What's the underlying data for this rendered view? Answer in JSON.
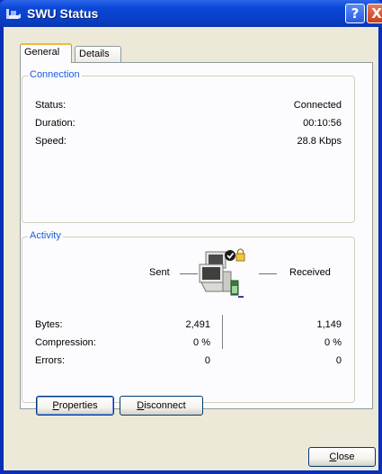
{
  "window": {
    "title": "SWU Status",
    "help_glyph": "?",
    "close_glyph": "X"
  },
  "tabs": [
    {
      "label": "General",
      "active": true
    },
    {
      "label": "Details",
      "active": false
    }
  ],
  "connection": {
    "legend": "Connection",
    "rows": [
      {
        "label": "Status:",
        "value": "Connected"
      },
      {
        "label": "Duration:",
        "value": "00:10:56"
      },
      {
        "label": "Speed:",
        "value": "28.8 Kbps"
      }
    ]
  },
  "activity": {
    "legend": "Activity",
    "sent_label": "Sent",
    "received_label": "Received",
    "rows": [
      {
        "label": "Bytes:",
        "sent": "2,491",
        "received": "1,149"
      },
      {
        "label": "Compression:",
        "sent": "0 %",
        "received": "0 %"
      },
      {
        "label": "Errors:",
        "sent": "0",
        "received": "0"
      }
    ]
  },
  "buttons": {
    "properties": {
      "pre": "",
      "accel": "P",
      "post": "roperties"
    },
    "disconnect": {
      "pre": "",
      "accel": "D",
      "post": "isconnect"
    },
    "close": {
      "pre": "",
      "accel": "C",
      "post": "lose"
    }
  },
  "colors": {
    "titlebar": "#0a47d8",
    "legend_text": "#1d5be0",
    "dialog_bg": "#ece9d8"
  },
  "icons": {
    "title": "network-connection-icon",
    "activity": "network-computers-icon"
  }
}
